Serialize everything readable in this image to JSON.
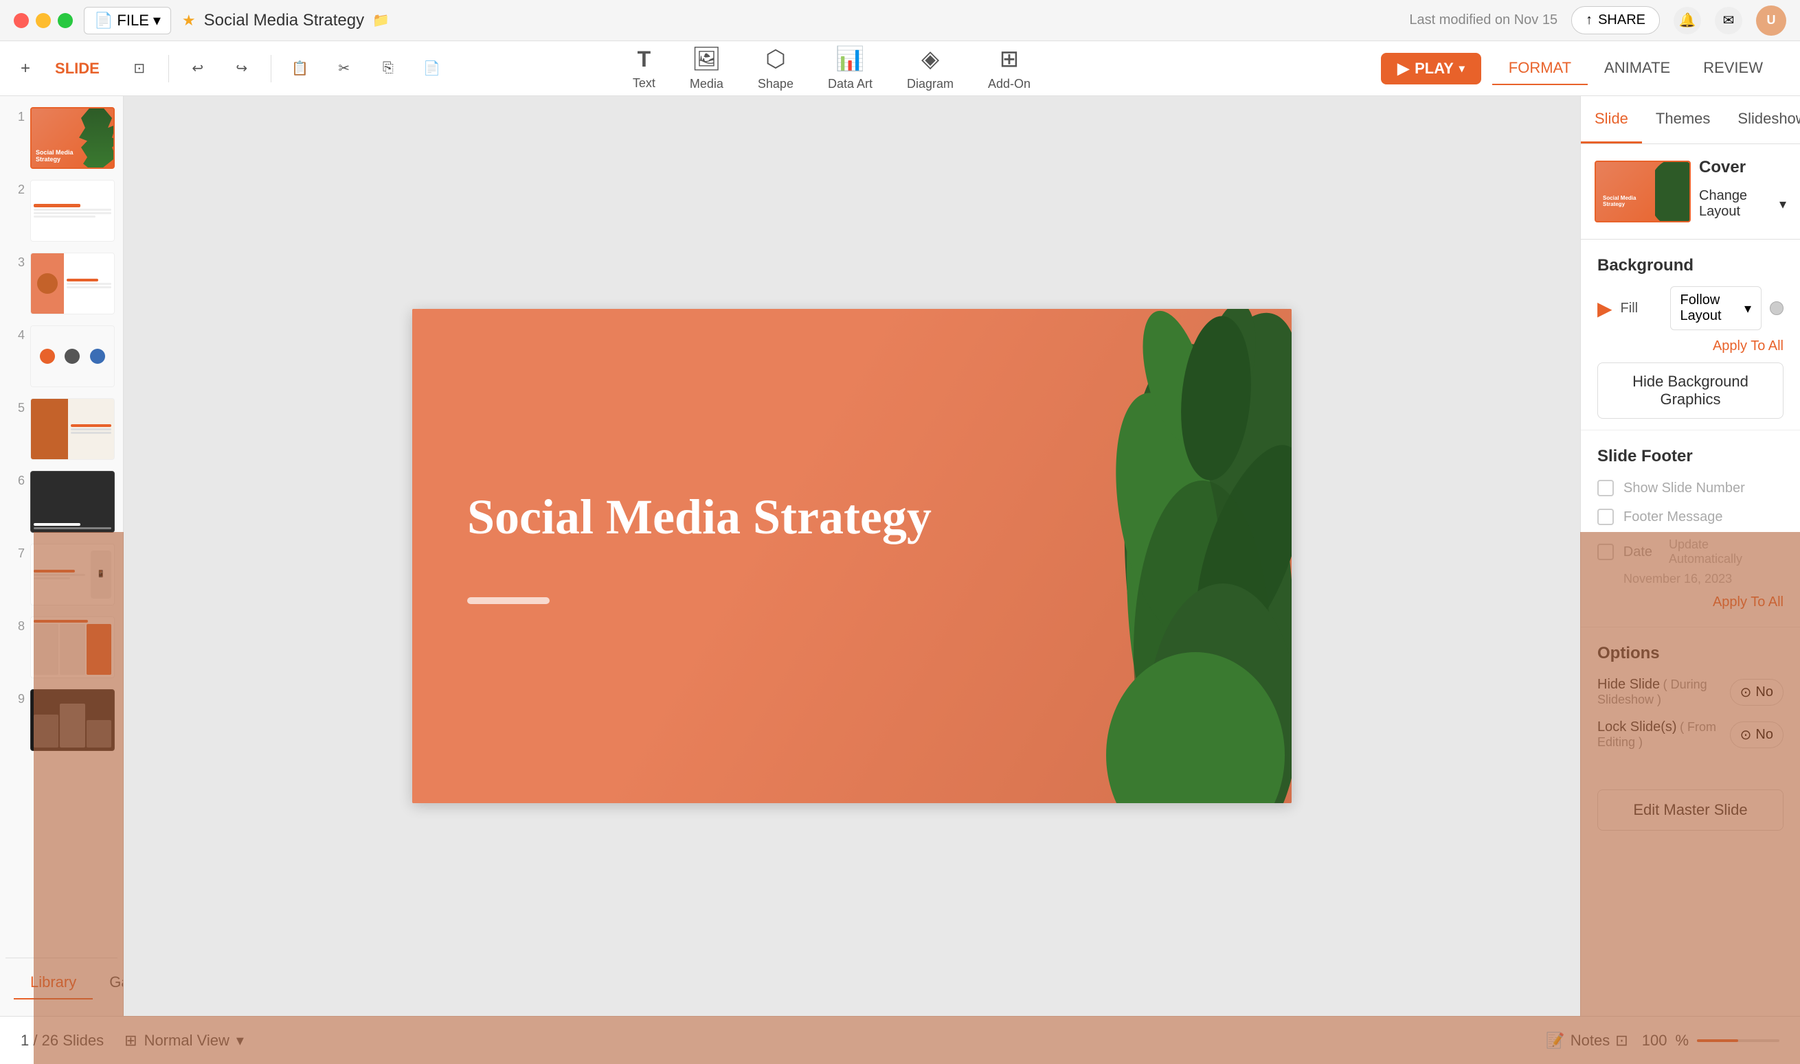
{
  "window": {
    "title": "Social Media Strategy",
    "modified": "Last modified on Nov 15"
  },
  "titlebar": {
    "file_label": "FILE",
    "star_icon": "★",
    "folder_icon": "📁",
    "share_label": "SHARE",
    "bell_icon": "🔔",
    "mail_icon": "✉",
    "avatar_initials": "U"
  },
  "toolbar": {
    "plus_label": "+",
    "slide_label": "SLIDE",
    "undo_icon": "↩",
    "redo_icon": "↪",
    "copy_style_icon": "📋",
    "cut_icon": "✂",
    "copy_icon": "⎘",
    "paste_icon": "📄",
    "tools": [
      {
        "id": "text",
        "icon": "T",
        "label": "Text"
      },
      {
        "id": "media",
        "icon": "🖼",
        "label": "Media"
      },
      {
        "id": "shape",
        "icon": "⬡",
        "label": "Shape"
      },
      {
        "id": "dataart",
        "icon": "📊",
        "label": "Data Art"
      },
      {
        "id": "diagram",
        "icon": "◈",
        "label": "Diagram"
      },
      {
        "id": "addon",
        "icon": "⊞",
        "label": "Add-On"
      }
    ],
    "play_label": "PLAY",
    "format_tabs": [
      "FORMAT",
      "ANIMATE",
      "REVIEW"
    ]
  },
  "slides": [
    {
      "num": "1",
      "type": "cover",
      "active": true
    },
    {
      "num": "2",
      "type": "list"
    },
    {
      "num": "3",
      "type": "person"
    },
    {
      "num": "4",
      "type": "circles"
    },
    {
      "num": "5",
      "type": "brand"
    },
    {
      "num": "6",
      "type": "dark-photo"
    },
    {
      "num": "7",
      "type": "phone"
    },
    {
      "num": "8",
      "type": "content"
    },
    {
      "num": "9",
      "type": "dark-gallery"
    }
  ],
  "slide_content": {
    "title": "Social Media Strategy",
    "decoration_color": "rgba(255,255,255,0.7)"
  },
  "right_panel": {
    "tabs": [
      "Slide",
      "Themes",
      "Slideshow"
    ],
    "active_tab": "Slide",
    "layout_name": "Cover",
    "change_layout_label": "Change Layout",
    "background_section": {
      "title": "Background",
      "fill_label": "Fill",
      "fill_value": "Follow Layout",
      "apply_all_label": "Apply To All",
      "hide_bg_label": "Hide Background Graphics"
    },
    "footer_section": {
      "title": "Slide Footer",
      "show_slide_number_label": "Show Slide Number",
      "footer_message_label": "Footer Message",
      "date_label": "Date",
      "date_hint": "Update Automatically",
      "date_value": "November 16, 2023",
      "apply_all_label": "Apply To All"
    },
    "options_section": {
      "title": "Options",
      "hide_slide_label": "Hide Slide",
      "hide_slide_sub": "( During Slideshow )",
      "hide_slide_value": "No",
      "lock_slide_label": "Lock Slide(s)",
      "lock_slide_sub": "( From Editing )",
      "lock_slide_value": "No"
    },
    "edit_master_label": "Edit Master Slide"
  },
  "bottom_bar": {
    "current_slide": "1",
    "total_slides": "26 Slides",
    "view_mode": "Normal View",
    "notes_label": "Notes",
    "zoom_level": "100",
    "zoom_symbol": "%",
    "library_label": "Library",
    "gallery_label": "Gallery"
  }
}
